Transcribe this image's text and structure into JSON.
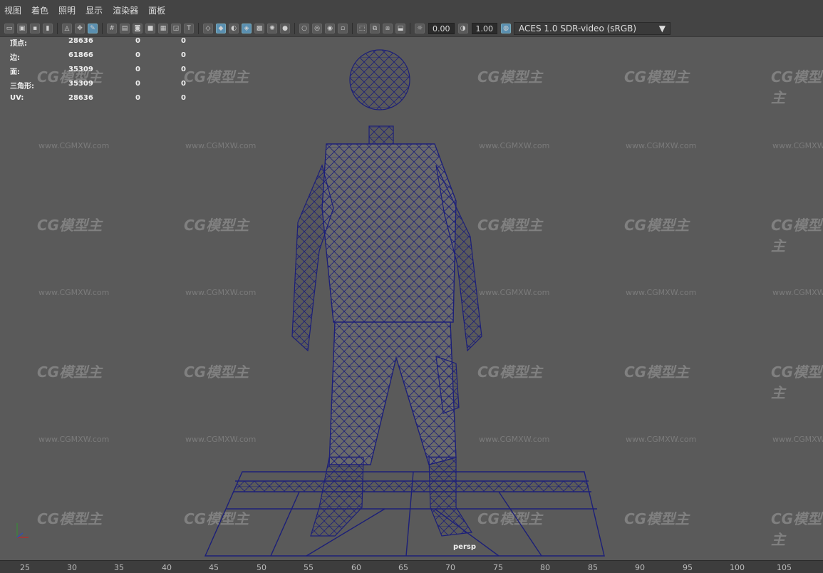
{
  "menu": [
    "视图",
    "着色",
    "照明",
    "显示",
    "渲染器",
    "面板"
  ],
  "toolbar": {
    "exposure": "0.00",
    "gamma": "1.00",
    "color_space": "ACES 1.0 SDR-video (sRGB)"
  },
  "hud": {
    "rows": [
      {
        "label": "顶点:",
        "c1": "28636",
        "c2": "0",
        "c3": "0"
      },
      {
        "label": "边:",
        "c1": "61866",
        "c2": "0",
        "c3": "0"
      },
      {
        "label": "面:",
        "c1": "35309",
        "c2": "0",
        "c3": "0"
      },
      {
        "label": "三角形:",
        "c1": "35309",
        "c2": "0",
        "c3": "0"
      },
      {
        "label": "UV:",
        "c1": "28636",
        "c2": "0",
        "c3": "0"
      }
    ]
  },
  "watermark": {
    "logo": "CG模型主",
    "url": "www.CGMXW.com"
  },
  "camera_label": "persp",
  "ruler_ticks": [
    "25",
    "30",
    "35",
    "40",
    "45",
    "50",
    "55",
    "60",
    "65",
    "70",
    "75",
    "80",
    "85",
    "90",
    "95",
    "100",
    "105"
  ]
}
